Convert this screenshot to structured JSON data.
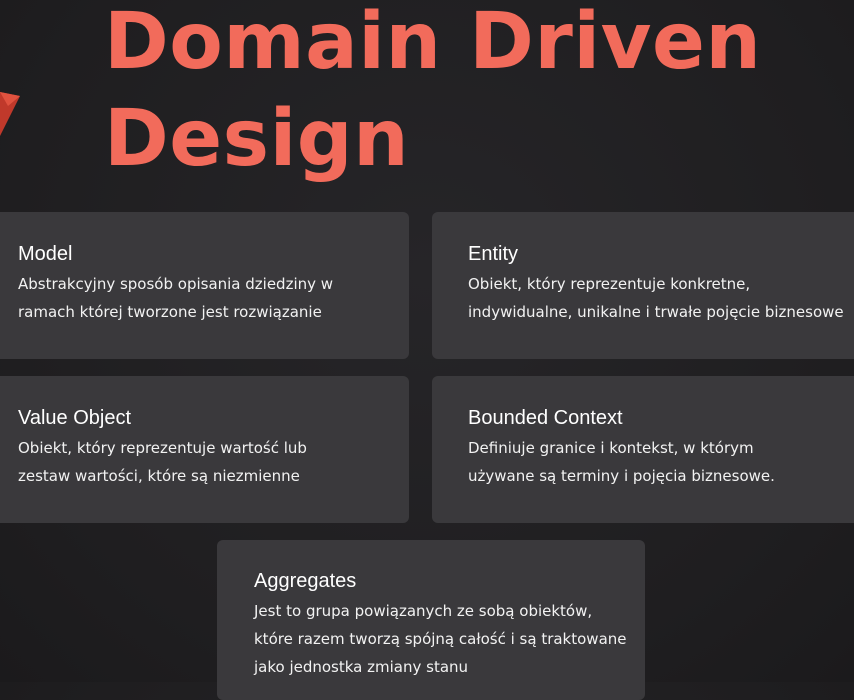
{
  "title": {
    "line1": "Domain Driven",
    "line2": "Design"
  },
  "colors": {
    "accent": "#f26b5b",
    "background": "#1f1e20",
    "card": "#3a393c",
    "text": "#ffffff"
  },
  "cards": [
    {
      "title": "Model",
      "desc": [
        "Abstrakcyjny sposób opisania dziedziny w",
        "ramach której tworzone jest rozwiązanie"
      ]
    },
    {
      "title": "Entity",
      "desc": [
        "Obiekt, który reprezentuje konkretne,",
        "indywidualne, unikalne i trwałe pojęcie biznesowe"
      ]
    },
    {
      "title": "Value Object",
      "desc": [
        "Obiekt, który reprezentuje wartość lub",
        "zestaw wartości, które są niezmienne"
      ]
    },
    {
      "title": "Bounded Context",
      "desc": [
        "Definiuje granice i kontekst, w którym",
        "używane są terminy i pojęcia biznesowe."
      ]
    },
    {
      "title": "Aggregates",
      "desc": [
        "Jest to grupa powiązanych ze sobą obiektów,",
        "które razem tworzą spójną całość i są traktowane",
        "jako jednostka zmiany stanu"
      ]
    }
  ]
}
